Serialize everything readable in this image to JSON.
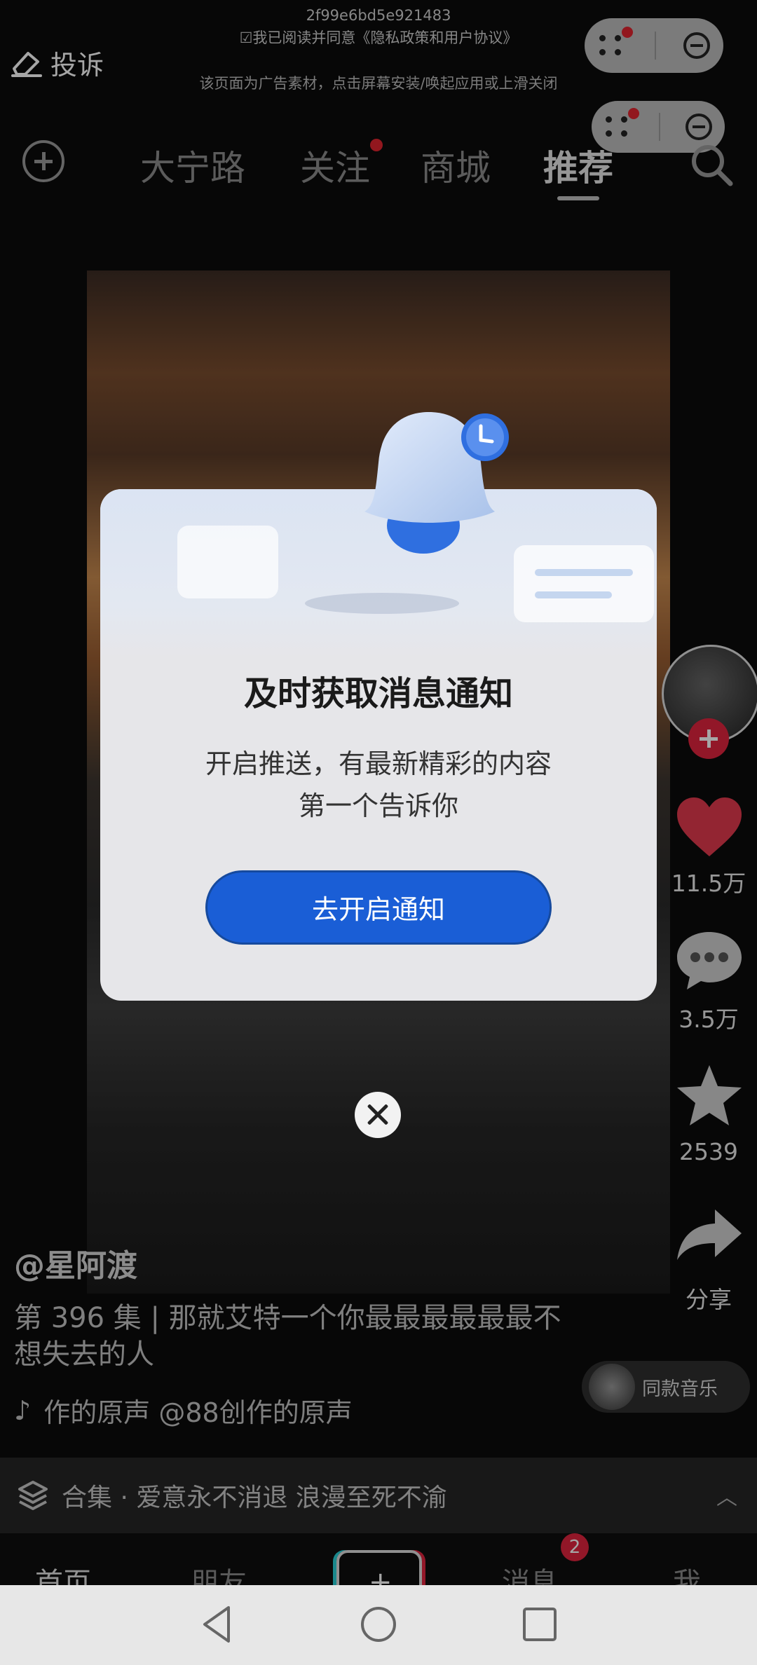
{
  "ad": {
    "id_code": "2f99e6bd5e921483",
    "agreement": "☑我已阅读并同意《隐私政策和用户协议》",
    "note": "该页面为广告素材，点击屏幕安装/唤起应用或上滑关闭",
    "complain_label": "投诉"
  },
  "top_nav": {
    "tabs": [
      {
        "label": "大宁路"
      },
      {
        "label": "关注"
      },
      {
        "label": "商城"
      },
      {
        "label": "推荐"
      }
    ],
    "active_tab": "推荐"
  },
  "right_rail": {
    "likes": "11.5万",
    "comments": "3.5万",
    "favorites": "2539",
    "share_label": "分享"
  },
  "video_info": {
    "author": "@星阿渡",
    "description": "第 396 集 | 那就艾特一个你最最最最最最不想失去的人",
    "music_scroll": "作的原声    @88创作的原声",
    "same_music_label": "同款音乐",
    "collection": "合集 · 爱意永不消退 浪漫至死不渝"
  },
  "bottom_tabs": {
    "home": "首页",
    "friends": "朋友",
    "messages": "消息",
    "messages_badge": "2",
    "me": "我"
  },
  "modal": {
    "title": "及时获取消息通知",
    "body_line1": "开启推送，有最新精彩的内容",
    "body_line2": "第一个告诉你",
    "button": "去开启通知"
  },
  "colors": {
    "accent_blue": "#1a5ed6",
    "brand_red": "#e0243e"
  }
}
